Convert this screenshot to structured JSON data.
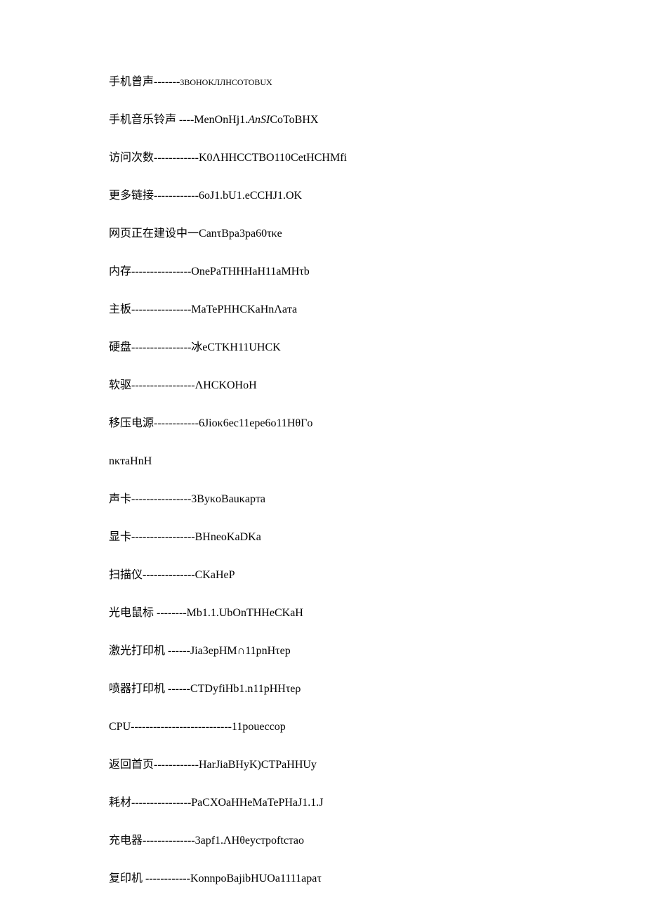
{
  "lines": [
    {
      "cn": "手机曾声",
      "dash": "-------",
      "lat": "3BOHOKЛЛHCOTOBUX",
      "latClass": "small"
    },
    {
      "cn": "手机音乐铃声",
      "dash": " ----",
      "lat": "MenOnHj1.",
      "latItalic": "AnSI",
      "latAfter": "CoToBHX"
    },
    {
      "cn": "访问次数",
      "dash": "------------",
      "lat": "K0ΛHHCCTBO110CetHCHMfi"
    },
    {
      "cn": "更多链接",
      "dash": "------------",
      "lat": "6oJ1.bU1.eCCHJ1.OK"
    },
    {
      "cn": "网页正在建设中一",
      "dash": "",
      "lat": "CanτBpa3pa60τκe"
    },
    {
      "cn": "内存",
      "dash": "----------------",
      "lat": "OnePaTHHHaH11aMHτb"
    },
    {
      "cn": "主板",
      "dash": "----------------",
      "lat": "MaTePHHCKaHnΛaтa"
    },
    {
      "cn": "硬盘",
      "dash": "----------------",
      "cn2": "冰",
      "lat": "eCTKH11UHCK"
    },
    {
      "cn": "软驱",
      "dash": "-----------------",
      "lat": "ΛHCKOHoH"
    },
    {
      "cn": "移压电源",
      "dash": "------------",
      "lat": "6Jioκ6ec11epe6o11HθΓo"
    },
    {
      "cn": "",
      "dash": "",
      "lat": "nκтaHnH"
    },
    {
      "cn": "声卡",
      "dash": "----------------",
      "lat": "3ByκoBauκapтa"
    },
    {
      "cn": "显卡",
      "dash": "-----------------",
      "lat": "BHneoKaDKa"
    },
    {
      "cn": "扫描仪",
      "dash": "--------------",
      "lat": "CKaHeP"
    },
    {
      "cn": "光电鼠标",
      "dash": " --------",
      "lat": "Mb1.1.UbOnTHHeCKaH"
    },
    {
      "cn": "激光打印机",
      "dash": " ------",
      "lat": "Jia3epHM∩11pnHτep"
    },
    {
      "cn": "喷器打印机",
      "dash": " ------",
      "lat": "CTDyfiHb1.n11pHHτeρ"
    },
    {
      "cn": "CPU",
      "dash": "---------------------------",
      "lat": "11poueccop",
      "cnClass": "lat"
    },
    {
      "cn": "返回首页",
      "dash": "------------",
      "lat": "HarJiaBHyK)CTPaHHUy"
    },
    {
      "cn": "耗材",
      "dash": "----------------",
      "lat": "PaCXOaHHeMaTePHaJ1.1.J"
    },
    {
      "cn": "充电器",
      "dash": "--------------",
      "lat": "3apf1.ΛHθeyстpoftcтao"
    },
    {
      "cn": "复印机",
      "dash": " ------------",
      "lat": "KonnpoBajibHUOa1111apaτ"
    }
  ]
}
